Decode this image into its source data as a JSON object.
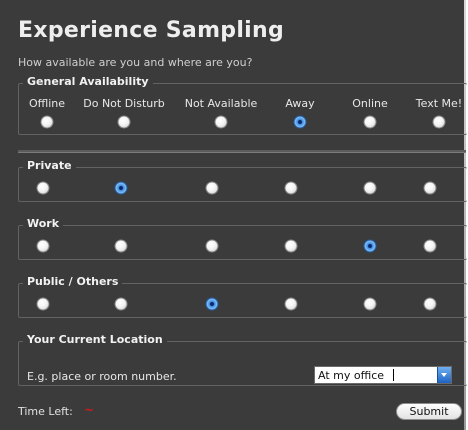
{
  "title": "Experience Sampling",
  "subtitle": "How available are you and where are you?",
  "general": {
    "label": "General Availability",
    "options": [
      "Offline",
      "Do Not Disturb",
      "Not Available",
      "Away",
      "Online",
      "Text Me!"
    ],
    "selected": "Away"
  },
  "private": {
    "label": "Private",
    "option_count": 6,
    "selected_index": 1
  },
  "work": {
    "label": "Work",
    "option_count": 6,
    "selected_index": 4
  },
  "public": {
    "label": "Public / Others",
    "option_count": 6,
    "selected_index": 2
  },
  "location": {
    "label": "Your Current Location",
    "hint": "E.g. place or room number.",
    "value": "At my office"
  },
  "footer": {
    "time_left_label": "Time Left:",
    "time_left_value": "~",
    "submit_label": "Submit"
  },
  "colors": {
    "background": "#3b3b3b",
    "selected_radio": "#3f8ddf",
    "time_value": "#d11a1a"
  },
  "icons": [
    "radio-icon",
    "radio-selected-icon",
    "dropdown-arrow-icon"
  ]
}
